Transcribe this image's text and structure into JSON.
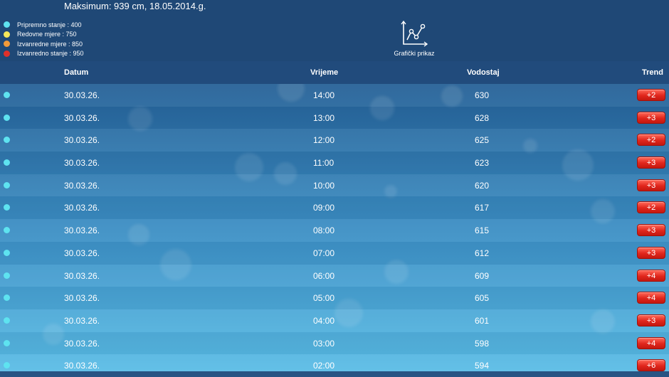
{
  "maximum_text": "Maksimum: 939 cm, 18.05.2014.g.",
  "legend": [
    {
      "label": "Pripremno stanje : 400",
      "color": "#5ee3f0"
    },
    {
      "label": "Redovne mjere : 750",
      "color": "#f5e85a"
    },
    {
      "label": "Izvanredne mjere : 850",
      "color": "#f29a3a"
    },
    {
      "label": "Izvanredno stanje : 950",
      "color": "#e0302a"
    }
  ],
  "graph_button": {
    "label": "Grafički prikaz",
    "icon": "line-chart-icon"
  },
  "table": {
    "headers": {
      "date": "Datum",
      "time": "Vrijeme",
      "level": "Vodostaj",
      "trend": "Trend"
    },
    "status_color": "#5ee3f0",
    "rows": [
      {
        "date": "30.03.26.",
        "time": "14:00",
        "level": "630",
        "trend": "+2"
      },
      {
        "date": "30.03.26.",
        "time": "13:00",
        "level": "628",
        "trend": "+3"
      },
      {
        "date": "30.03.26.",
        "time": "12:00",
        "level": "625",
        "trend": "+2"
      },
      {
        "date": "30.03.26.",
        "time": "11:00",
        "level": "623",
        "trend": "+3"
      },
      {
        "date": "30.03.26.",
        "time": "10:00",
        "level": "620",
        "trend": "+3"
      },
      {
        "date": "30.03.26.",
        "time": "09:00",
        "level": "617",
        "trend": "+2"
      },
      {
        "date": "30.03.26.",
        "time": "08:00",
        "level": "615",
        "trend": "+3"
      },
      {
        "date": "30.03.26.",
        "time": "07:00",
        "level": "612",
        "trend": "+3"
      },
      {
        "date": "30.03.26.",
        "time": "06:00",
        "level": "609",
        "trend": "+4"
      },
      {
        "date": "30.03.26.",
        "time": "05:00",
        "level": "605",
        "trend": "+4"
      },
      {
        "date": "30.03.26.",
        "time": "04:00",
        "level": "601",
        "trend": "+3"
      },
      {
        "date": "30.03.26.",
        "time": "03:00",
        "level": "598",
        "trend": "+4"
      },
      {
        "date": "30.03.26.",
        "time": "02:00",
        "level": "594",
        "trend": "+6"
      }
    ]
  }
}
